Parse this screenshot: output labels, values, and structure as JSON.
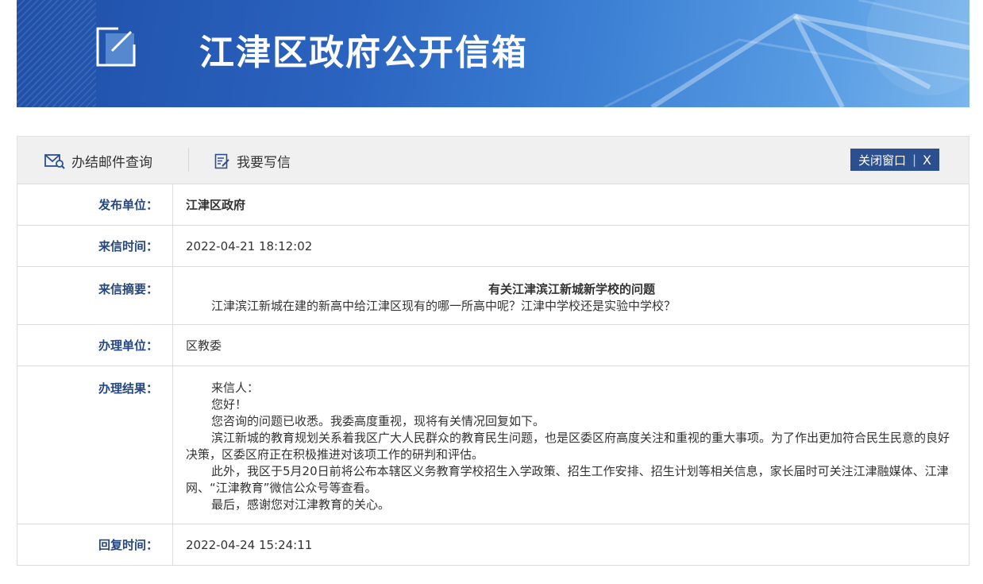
{
  "header": {
    "title": "江津区政府公开信箱"
  },
  "toolbar": {
    "query_label": "办结邮件查询",
    "write_label": "我要写信",
    "close_label": "关闭窗口",
    "close_sep": "|",
    "close_x": "X"
  },
  "fields": {
    "publisher": {
      "label": "发布单位：",
      "value": "江津区政府"
    },
    "received_time": {
      "label": "来信时间：",
      "value": "2022-04-21 18:12:02"
    },
    "summary": {
      "label": "来信摘要：",
      "title": "有关江津滨江新城新学校的问题",
      "content": "江津滨江新城在建的新高中给江津区现有的哪一所高中呢？江津中学校还是实验中学校？"
    },
    "handler": {
      "label": "办理单位：",
      "value": "区教委"
    },
    "result": {
      "label": "办理结果：",
      "paragraphs": [
        "来信人：",
        "您好！",
        "您咨询的问题已收悉。我委高度重视，现将有关情况回复如下。",
        "滨江新城的教育规划关系着我区广大人民群众的教育民生问题，也是区委区府高度关注和重视的重大事项。为了作出更加符合民生民意的良好决策，区委区府正在积极推进对该项工作的研判和评估。",
        "此外，我区于5月20日前将公布本辖区义务教育学校招生入学政策、招生工作安排、招生计划等相关信息，家长届时可关注江津融媒体、江津网、“江津教育”微信公众号等查看。",
        "最后，感谢您对江津教育的关心。"
      ]
    },
    "reply_time": {
      "label": "回复时间：",
      "value": "2022-04-24 15:24:11"
    }
  }
}
